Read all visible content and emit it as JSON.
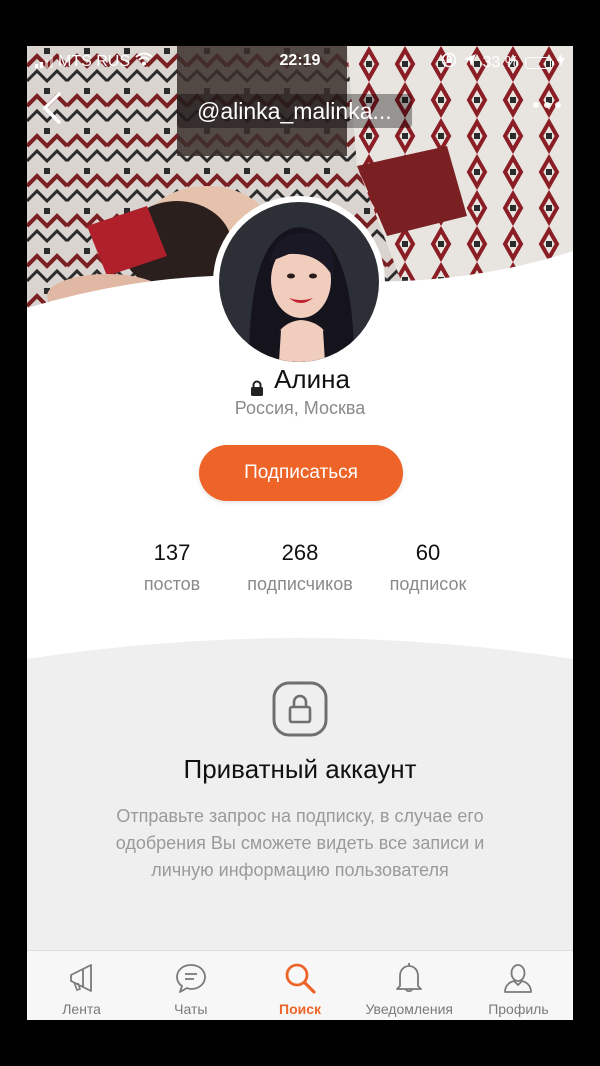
{
  "status_bar": {
    "carrier": "MTS RUS",
    "time": "22:19",
    "battery": "33 %",
    "battery_level": 0.33,
    "icons": [
      "signal-icon",
      "wifi-icon",
      "rotation-lock-icon",
      "location-icon",
      "battery-icon",
      "charging-icon"
    ]
  },
  "header": {
    "title": "@alinka_malinka...",
    "back_icon": "chevron-left-icon",
    "more_icon": "more-dots-icon"
  },
  "profile": {
    "name": "Алина",
    "location": "Россия, Москва",
    "subscribe_label": "Подписаться",
    "private_icon": "lock-icon"
  },
  "stats": [
    {
      "value": "137",
      "label": "постов"
    },
    {
      "value": "268",
      "label": "подписчиков"
    },
    {
      "value": "60",
      "label": "подписок"
    }
  ],
  "private_account": {
    "title": "Приватный аккаунт",
    "description": "Отправьте запрос на подписку, в случае его одобрения Вы сможете видеть все записи и личную информацию пользователя"
  },
  "tab_bar": {
    "active": "Поиск",
    "accent_color": "#ee6428",
    "items": [
      {
        "label": "Лента",
        "icon": "megaphone-icon"
      },
      {
        "label": "Чаты",
        "icon": "chat-bubble-icon"
      },
      {
        "label": "Поиск",
        "icon": "search-icon"
      },
      {
        "label": "Уведомления",
        "icon": "bell-icon"
      },
      {
        "label": "Профиль",
        "icon": "profile-icon"
      }
    ]
  },
  "colors": {
    "accent": "#ee6428",
    "muted_text": "#8a8a8a",
    "private_bg": "#efefef"
  }
}
